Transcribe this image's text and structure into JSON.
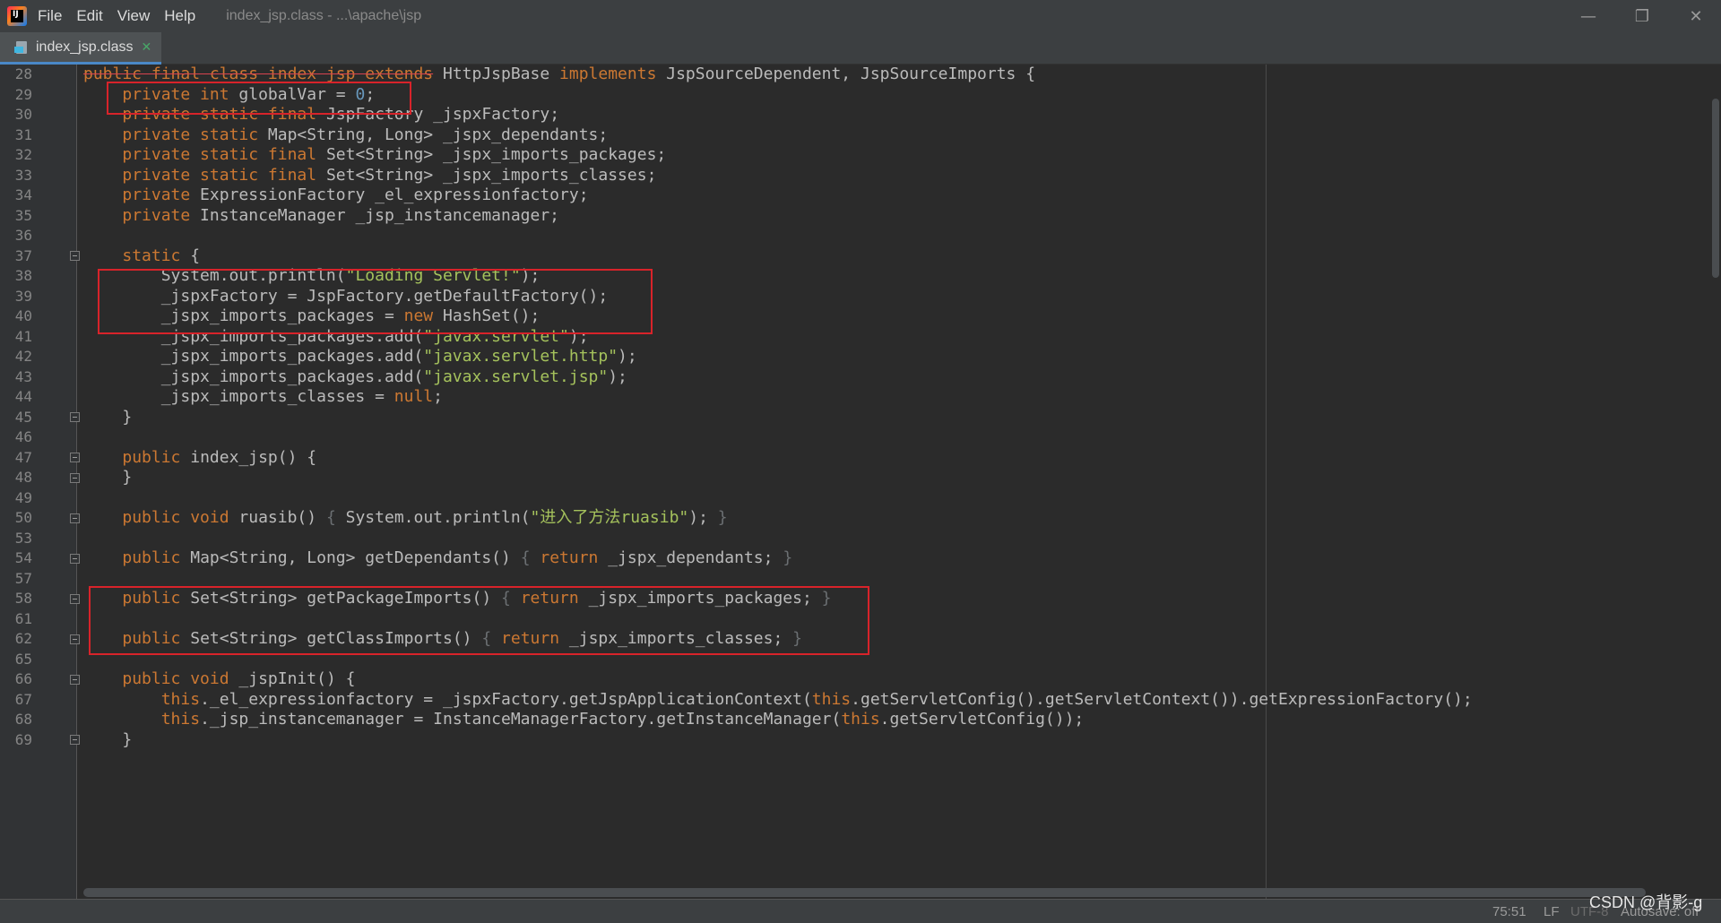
{
  "menu": {
    "file": "File",
    "edit": "Edit",
    "view": "View",
    "help": "Help"
  },
  "window_path": "index_jsp.class - ...\\apache\\jsp",
  "window_controls": {
    "minimize": "—",
    "restore": "❐",
    "close": "✕"
  },
  "tab": {
    "label": "index_jsp.class",
    "close": "✕"
  },
  "code_lines": [
    {
      "n": "28",
      "fold": false,
      "tokens": [
        {
          "t": "public final class index_jsp extends",
          "c": "kw strike-part"
        },
        {
          "t": " HttpJspBase ",
          "c": ""
        },
        {
          "t": "implements",
          "c": "kw"
        },
        {
          "t": " JspSourceDependent, JspSourceImports {",
          "c": ""
        }
      ]
    },
    {
      "n": "29",
      "fold": false,
      "tokens": [
        {
          "t": "    ",
          "c": ""
        },
        {
          "t": "private int",
          "c": "kw"
        },
        {
          "t": " globalVar = ",
          "c": ""
        },
        {
          "t": "0",
          "c": "num"
        },
        {
          "t": ";",
          "c": ""
        }
      ]
    },
    {
      "n": "30",
      "fold": false,
      "tokens": [
        {
          "t": "    ",
          "c": ""
        },
        {
          "t": "private static final",
          "c": "kw"
        },
        {
          "t": " JspFactory _jspxFactory;",
          "c": ""
        }
      ]
    },
    {
      "n": "31",
      "fold": false,
      "tokens": [
        {
          "t": "    ",
          "c": ""
        },
        {
          "t": "private static",
          "c": "kw"
        },
        {
          "t": " Map<String, Long> _jspx_dependants;",
          "c": ""
        }
      ]
    },
    {
      "n": "32",
      "fold": false,
      "tokens": [
        {
          "t": "    ",
          "c": ""
        },
        {
          "t": "private static final",
          "c": "kw"
        },
        {
          "t": " Set<String> _jspx_imports_packages;",
          "c": ""
        }
      ]
    },
    {
      "n": "33",
      "fold": false,
      "tokens": [
        {
          "t": "    ",
          "c": ""
        },
        {
          "t": "private static final",
          "c": "kw"
        },
        {
          "t": " Set<String> _jspx_imports_classes;",
          "c": ""
        }
      ]
    },
    {
      "n": "34",
      "fold": false,
      "tokens": [
        {
          "t": "    ",
          "c": ""
        },
        {
          "t": "private",
          "c": "kw"
        },
        {
          "t": " ExpressionFactory _el_expressionfactory;",
          "c": ""
        }
      ]
    },
    {
      "n": "35",
      "fold": false,
      "tokens": [
        {
          "t": "    ",
          "c": ""
        },
        {
          "t": "private",
          "c": "kw"
        },
        {
          "t": " InstanceManager _jsp_instancemanager;",
          "c": ""
        }
      ]
    },
    {
      "n": "36",
      "fold": false,
      "tokens": []
    },
    {
      "n": "37",
      "fold": true,
      "tokens": [
        {
          "t": "    ",
          "c": ""
        },
        {
          "t": "static",
          "c": "kw"
        },
        {
          "t": " {",
          "c": ""
        }
      ]
    },
    {
      "n": "38",
      "fold": false,
      "tokens": [
        {
          "t": "        System.out.println(",
          "c": ""
        },
        {
          "t": "\"Loading Servlet!\"",
          "c": "str"
        },
        {
          "t": ");",
          "c": ""
        }
      ]
    },
    {
      "n": "39",
      "fold": false,
      "tokens": [
        {
          "t": "        _jspxFactory = JspFactory.getDefaultFactory();",
          "c": ""
        }
      ]
    },
    {
      "n": "40",
      "fold": false,
      "tokens": [
        {
          "t": "        _jspx_imports_packages = ",
          "c": ""
        },
        {
          "t": "new",
          "c": "kw"
        },
        {
          "t": " HashSet();",
          "c": ""
        }
      ]
    },
    {
      "n": "41",
      "fold": false,
      "tokens": [
        {
          "t": "        _jspx_imports_packages.add(",
          "c": ""
        },
        {
          "t": "\"javax.servlet\"",
          "c": "str"
        },
        {
          "t": ");",
          "c": ""
        }
      ]
    },
    {
      "n": "42",
      "fold": false,
      "tokens": [
        {
          "t": "        _jspx_imports_packages.add(",
          "c": ""
        },
        {
          "t": "\"javax.servlet.http\"",
          "c": "str"
        },
        {
          "t": ");",
          "c": ""
        }
      ]
    },
    {
      "n": "43",
      "fold": false,
      "tokens": [
        {
          "t": "        _jspx_imports_packages.add(",
          "c": ""
        },
        {
          "t": "\"javax.servlet.jsp\"",
          "c": "str"
        },
        {
          "t": ");",
          "c": ""
        }
      ]
    },
    {
      "n": "44",
      "fold": false,
      "tokens": [
        {
          "t": "        _jspx_imports_classes = ",
          "c": ""
        },
        {
          "t": "null",
          "c": "kw"
        },
        {
          "t": ";",
          "c": ""
        }
      ]
    },
    {
      "n": "45",
      "fold": true,
      "tokens": [
        {
          "t": "    }",
          "c": ""
        }
      ]
    },
    {
      "n": "46",
      "fold": false,
      "tokens": []
    },
    {
      "n": "47",
      "fold": true,
      "tokens": [
        {
          "t": "    ",
          "c": ""
        },
        {
          "t": "public",
          "c": "kw"
        },
        {
          "t": " index_jsp() {",
          "c": ""
        }
      ]
    },
    {
      "n": "48",
      "fold": true,
      "tokens": [
        {
          "t": "    }",
          "c": ""
        }
      ]
    },
    {
      "n": "49",
      "fold": false,
      "tokens": []
    },
    {
      "n": "50",
      "fold": true,
      "tokens": [
        {
          "t": "    ",
          "c": ""
        },
        {
          "t": "public void",
          "c": "kw"
        },
        {
          "t": " ruasib() ",
          "c": ""
        },
        {
          "t": "{",
          "c": "brace-dim"
        },
        {
          "t": " System.out.println(",
          "c": ""
        },
        {
          "t": "\"进入了方法ruasib\"",
          "c": "str"
        },
        {
          "t": "); ",
          "c": ""
        },
        {
          "t": "}",
          "c": "brace-dim"
        }
      ]
    },
    {
      "n": "53",
      "fold": false,
      "tokens": []
    },
    {
      "n": "54",
      "fold": true,
      "tokens": [
        {
          "t": "    ",
          "c": ""
        },
        {
          "t": "public",
          "c": "kw"
        },
        {
          "t": " Map<String, Long> getDependants() ",
          "c": ""
        },
        {
          "t": "{",
          "c": "brace-dim"
        },
        {
          "t": " ",
          "c": ""
        },
        {
          "t": "return",
          "c": "kw"
        },
        {
          "t": " _jspx_dependants; ",
          "c": ""
        },
        {
          "t": "}",
          "c": "brace-dim"
        }
      ]
    },
    {
      "n": "57",
      "fold": false,
      "tokens": []
    },
    {
      "n": "58",
      "fold": true,
      "tokens": [
        {
          "t": "    ",
          "c": ""
        },
        {
          "t": "public",
          "c": "kw"
        },
        {
          "t": " Set<String> getPackageImports() ",
          "c": ""
        },
        {
          "t": "{",
          "c": "brace-dim"
        },
        {
          "t": " ",
          "c": ""
        },
        {
          "t": "return",
          "c": "kw"
        },
        {
          "t": " _jspx_imports_packages; ",
          "c": ""
        },
        {
          "t": "}",
          "c": "brace-dim"
        }
      ]
    },
    {
      "n": "61",
      "fold": false,
      "tokens": []
    },
    {
      "n": "62",
      "fold": true,
      "tokens": [
        {
          "t": "    ",
          "c": ""
        },
        {
          "t": "public",
          "c": "kw"
        },
        {
          "t": " Set<String> getClassImports() ",
          "c": ""
        },
        {
          "t": "{",
          "c": "brace-dim"
        },
        {
          "t": " ",
          "c": ""
        },
        {
          "t": "return",
          "c": "kw"
        },
        {
          "t": " _jspx_imports_classes; ",
          "c": ""
        },
        {
          "t": "}",
          "c": "brace-dim"
        }
      ]
    },
    {
      "n": "65",
      "fold": false,
      "tokens": []
    },
    {
      "n": "66",
      "fold": true,
      "tokens": [
        {
          "t": "    ",
          "c": ""
        },
        {
          "t": "public void",
          "c": "kw"
        },
        {
          "t": " _jspInit() {",
          "c": ""
        }
      ]
    },
    {
      "n": "67",
      "fold": false,
      "tokens": [
        {
          "t": "        ",
          "c": ""
        },
        {
          "t": "this",
          "c": "kw"
        },
        {
          "t": "._el_expressionfactory = _jspxFactory.getJspApplicationContext(",
          "c": ""
        },
        {
          "t": "this",
          "c": "kw"
        },
        {
          "t": ".getServletConfig().getServletContext()).getExpressionFactory();",
          "c": ""
        }
      ]
    },
    {
      "n": "68",
      "fold": false,
      "tokens": [
        {
          "t": "        ",
          "c": ""
        },
        {
          "t": "this",
          "c": "kw"
        },
        {
          "t": "._jsp_instancemanager = InstanceManagerFactory.getInstanceManager(",
          "c": ""
        },
        {
          "t": "this",
          "c": "kw"
        },
        {
          "t": ".getServletConfig());",
          "c": ""
        }
      ]
    },
    {
      "n": "69",
      "fold": true,
      "tokens": [
        {
          "t": "    }",
          "c": ""
        }
      ]
    }
  ],
  "status": {
    "position": "75:51",
    "line_ending": "LF",
    "encoding": "UTF-8",
    "autosave": "Autosave: off"
  },
  "watermark": "CSDN @背影-g",
  "colors": {
    "keyword": "#cc7832",
    "string": "#a5c25c",
    "number": "#6897bb",
    "highlight_box": "#d8232a",
    "background": "#2b2b2b"
  }
}
